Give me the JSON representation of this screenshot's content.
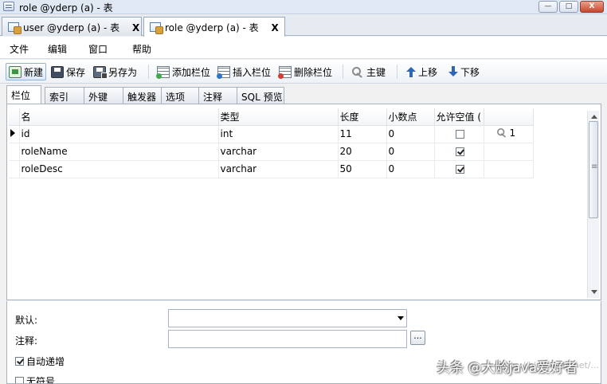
{
  "window": {
    "title": "role @yderp (a) - 表",
    "buttons": {
      "minimize": "—",
      "maximize": "□",
      "close": "X"
    }
  },
  "tabs": [
    {
      "label": "user @yderp (a) - 表",
      "close": "X"
    },
    {
      "label": "role @yderp (a) - 表",
      "close": "X"
    }
  ],
  "menu": [
    "文件",
    "编辑",
    "窗口",
    "帮助"
  ],
  "toolbar": {
    "new": "新建",
    "save": "保存",
    "save_as": "另存为",
    "add_field": "添加栏位",
    "insert_field": "插入栏位",
    "delete_field": "删除栏位",
    "primary_key": "主键",
    "move_up": "上移",
    "move_down": "下移"
  },
  "subtabs": [
    "栏位",
    "索引",
    "外键",
    "触发器",
    "选项",
    "注释",
    "SQL 预览"
  ],
  "table": {
    "headers": [
      "名",
      "类型",
      "长度",
      "小数点",
      "允许空值 (",
      ""
    ],
    "rows": [
      {
        "name": "id",
        "type": "int",
        "length": "11",
        "decimal": "0",
        "nullable": false,
        "key_order": "1",
        "selected": true
      },
      {
        "name": "roleName",
        "type": "varchar",
        "length": "20",
        "decimal": "0",
        "nullable": true,
        "key_order": "",
        "selected": false
      },
      {
        "name": "roleDesc",
        "type": "varchar",
        "length": "50",
        "decimal": "0",
        "nullable": true,
        "key_order": "",
        "selected": false
      }
    ]
  },
  "properties": {
    "default_label": "默认:",
    "default_value": "",
    "comment_label": "注释:",
    "comment_value": "",
    "ellipsis": "...",
    "auto_increment_label": "自动递增",
    "auto_increment": true,
    "unsigned_label": "无符号",
    "unsigned": false
  },
  "watermark": {
    "text": "头条 @大龄java爱好者",
    "url_text": "https://blog.csdn.net/..."
  }
}
